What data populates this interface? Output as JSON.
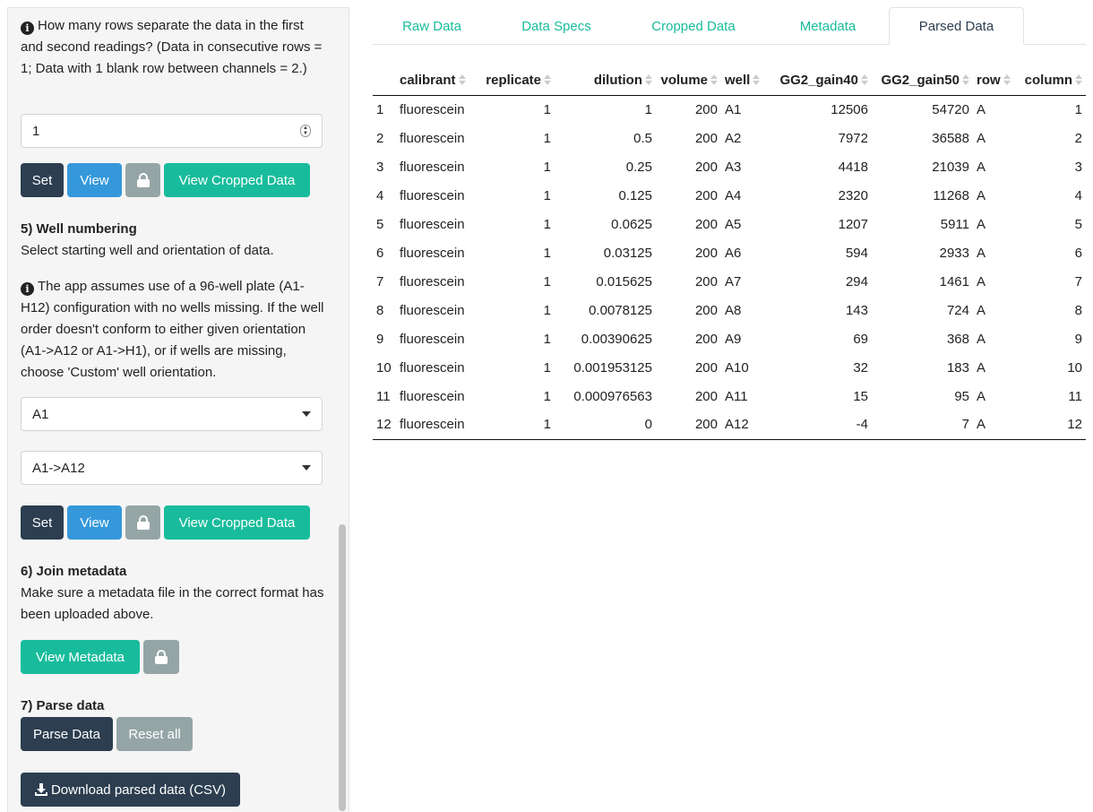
{
  "sidebar": {
    "step4_info": "How many rows separate the data in the first and second readings? (Data in consecutive rows = 1; Data with 1 blank row between channels = 2.)",
    "step4_value": "1",
    "step4_buttons": {
      "set": "Set",
      "view": "View",
      "view_cropped": "View Cropped Data"
    },
    "step5_title": "5) Well numbering",
    "step5_desc": "Select starting well and orientation of data.",
    "step5_info": "The app assumes use of a 96-well plate (A1-H12) configuration with no wells missing. If the well order doesn't conform to either given orientation (A1->A12 or A1->H1), or if wells are missing, choose 'Custom' well orientation.",
    "start_well": "A1",
    "orientation": "A1->A12",
    "step5_buttons": {
      "set": "Set",
      "view": "View",
      "view_cropped": "View Cropped Data"
    },
    "step6_title": "6) Join metadata",
    "step6_desc": "Make sure a metadata file in the correct format has been uploaded above.",
    "view_metadata": "View Metadata",
    "step7_title": "7) Parse data",
    "parse": "Parse Data",
    "reset": "Reset all",
    "download": "Download parsed data (CSV)"
  },
  "tabs": [
    "Raw Data",
    "Data Specs",
    "Cropped Data",
    "Metadata",
    "Parsed Data"
  ],
  "active_tab": "Parsed Data",
  "table": {
    "headers": [
      "calibrant",
      "replicate",
      "dilution",
      "volume",
      "well",
      "GG2_gain40",
      "GG2_gain50",
      "row",
      "column"
    ],
    "rows": [
      [
        "1",
        "fluorescein",
        "1",
        "1",
        "200",
        "A1",
        "12506",
        "54720",
        "A",
        "1"
      ],
      [
        "2",
        "fluorescein",
        "1",
        "0.5",
        "200",
        "A2",
        "7972",
        "36588",
        "A",
        "2"
      ],
      [
        "3",
        "fluorescein",
        "1",
        "0.25",
        "200",
        "A3",
        "4418",
        "21039",
        "A",
        "3"
      ],
      [
        "4",
        "fluorescein",
        "1",
        "0.125",
        "200",
        "A4",
        "2320",
        "11268",
        "A",
        "4"
      ],
      [
        "5",
        "fluorescein",
        "1",
        "0.0625",
        "200",
        "A5",
        "1207",
        "5911",
        "A",
        "5"
      ],
      [
        "6",
        "fluorescein",
        "1",
        "0.03125",
        "200",
        "A6",
        "594",
        "2933",
        "A",
        "6"
      ],
      [
        "7",
        "fluorescein",
        "1",
        "0.015625",
        "200",
        "A7",
        "294",
        "1461",
        "A",
        "7"
      ],
      [
        "8",
        "fluorescein",
        "1",
        "0.0078125",
        "200",
        "A8",
        "143",
        "724",
        "A",
        "8"
      ],
      [
        "9",
        "fluorescein",
        "1",
        "0.00390625",
        "200",
        "A9",
        "69",
        "368",
        "A",
        "9"
      ],
      [
        "10",
        "fluorescein",
        "1",
        "0.001953125",
        "200",
        "A10",
        "32",
        "183",
        "A",
        "10"
      ],
      [
        "11",
        "fluorescein",
        "1",
        "0.000976563",
        "200",
        "A11",
        "15",
        "95",
        "A",
        "11"
      ],
      [
        "12",
        "fluorescein",
        "1",
        "0",
        "200",
        "A12",
        "-4",
        "7",
        "A",
        "12"
      ]
    ]
  }
}
